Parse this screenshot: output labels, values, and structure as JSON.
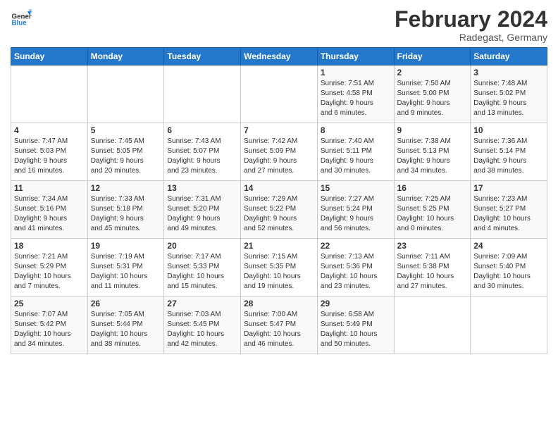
{
  "logo": {
    "general": "General",
    "blue": "Blue"
  },
  "title": {
    "month": "February 2024",
    "location": "Radegast, Germany"
  },
  "headers": [
    "Sunday",
    "Monday",
    "Tuesday",
    "Wednesday",
    "Thursday",
    "Friday",
    "Saturday"
  ],
  "weeks": [
    [
      {
        "day": "",
        "info": ""
      },
      {
        "day": "",
        "info": ""
      },
      {
        "day": "",
        "info": ""
      },
      {
        "day": "",
        "info": ""
      },
      {
        "day": "1",
        "info": "Sunrise: 7:51 AM\nSunset: 4:58 PM\nDaylight: 9 hours\nand 6 minutes."
      },
      {
        "day": "2",
        "info": "Sunrise: 7:50 AM\nSunset: 5:00 PM\nDaylight: 9 hours\nand 9 minutes."
      },
      {
        "day": "3",
        "info": "Sunrise: 7:48 AM\nSunset: 5:02 PM\nDaylight: 9 hours\nand 13 minutes."
      }
    ],
    [
      {
        "day": "4",
        "info": "Sunrise: 7:47 AM\nSunset: 5:03 PM\nDaylight: 9 hours\nand 16 minutes."
      },
      {
        "day": "5",
        "info": "Sunrise: 7:45 AM\nSunset: 5:05 PM\nDaylight: 9 hours\nand 20 minutes."
      },
      {
        "day": "6",
        "info": "Sunrise: 7:43 AM\nSunset: 5:07 PM\nDaylight: 9 hours\nand 23 minutes."
      },
      {
        "day": "7",
        "info": "Sunrise: 7:42 AM\nSunset: 5:09 PM\nDaylight: 9 hours\nand 27 minutes."
      },
      {
        "day": "8",
        "info": "Sunrise: 7:40 AM\nSunset: 5:11 PM\nDaylight: 9 hours\nand 30 minutes."
      },
      {
        "day": "9",
        "info": "Sunrise: 7:38 AM\nSunset: 5:13 PM\nDaylight: 9 hours\nand 34 minutes."
      },
      {
        "day": "10",
        "info": "Sunrise: 7:36 AM\nSunset: 5:14 PM\nDaylight: 9 hours\nand 38 minutes."
      }
    ],
    [
      {
        "day": "11",
        "info": "Sunrise: 7:34 AM\nSunset: 5:16 PM\nDaylight: 9 hours\nand 41 minutes."
      },
      {
        "day": "12",
        "info": "Sunrise: 7:33 AM\nSunset: 5:18 PM\nDaylight: 9 hours\nand 45 minutes."
      },
      {
        "day": "13",
        "info": "Sunrise: 7:31 AM\nSunset: 5:20 PM\nDaylight: 9 hours\nand 49 minutes."
      },
      {
        "day": "14",
        "info": "Sunrise: 7:29 AM\nSunset: 5:22 PM\nDaylight: 9 hours\nand 52 minutes."
      },
      {
        "day": "15",
        "info": "Sunrise: 7:27 AM\nSunset: 5:24 PM\nDaylight: 9 hours\nand 56 minutes."
      },
      {
        "day": "16",
        "info": "Sunrise: 7:25 AM\nSunset: 5:25 PM\nDaylight: 10 hours\nand 0 minutes."
      },
      {
        "day": "17",
        "info": "Sunrise: 7:23 AM\nSunset: 5:27 PM\nDaylight: 10 hours\nand 4 minutes."
      }
    ],
    [
      {
        "day": "18",
        "info": "Sunrise: 7:21 AM\nSunset: 5:29 PM\nDaylight: 10 hours\nand 7 minutes."
      },
      {
        "day": "19",
        "info": "Sunrise: 7:19 AM\nSunset: 5:31 PM\nDaylight: 10 hours\nand 11 minutes."
      },
      {
        "day": "20",
        "info": "Sunrise: 7:17 AM\nSunset: 5:33 PM\nDaylight: 10 hours\nand 15 minutes."
      },
      {
        "day": "21",
        "info": "Sunrise: 7:15 AM\nSunset: 5:35 PM\nDaylight: 10 hours\nand 19 minutes."
      },
      {
        "day": "22",
        "info": "Sunrise: 7:13 AM\nSunset: 5:36 PM\nDaylight: 10 hours\nand 23 minutes."
      },
      {
        "day": "23",
        "info": "Sunrise: 7:11 AM\nSunset: 5:38 PM\nDaylight: 10 hours\nand 27 minutes."
      },
      {
        "day": "24",
        "info": "Sunrise: 7:09 AM\nSunset: 5:40 PM\nDaylight: 10 hours\nand 30 minutes."
      }
    ],
    [
      {
        "day": "25",
        "info": "Sunrise: 7:07 AM\nSunset: 5:42 PM\nDaylight: 10 hours\nand 34 minutes."
      },
      {
        "day": "26",
        "info": "Sunrise: 7:05 AM\nSunset: 5:44 PM\nDaylight: 10 hours\nand 38 minutes."
      },
      {
        "day": "27",
        "info": "Sunrise: 7:03 AM\nSunset: 5:45 PM\nDaylight: 10 hours\nand 42 minutes."
      },
      {
        "day": "28",
        "info": "Sunrise: 7:00 AM\nSunset: 5:47 PM\nDaylight: 10 hours\nand 46 minutes."
      },
      {
        "day": "29",
        "info": "Sunrise: 6:58 AM\nSunset: 5:49 PM\nDaylight: 10 hours\nand 50 minutes."
      },
      {
        "day": "",
        "info": ""
      },
      {
        "day": "",
        "info": ""
      }
    ]
  ]
}
